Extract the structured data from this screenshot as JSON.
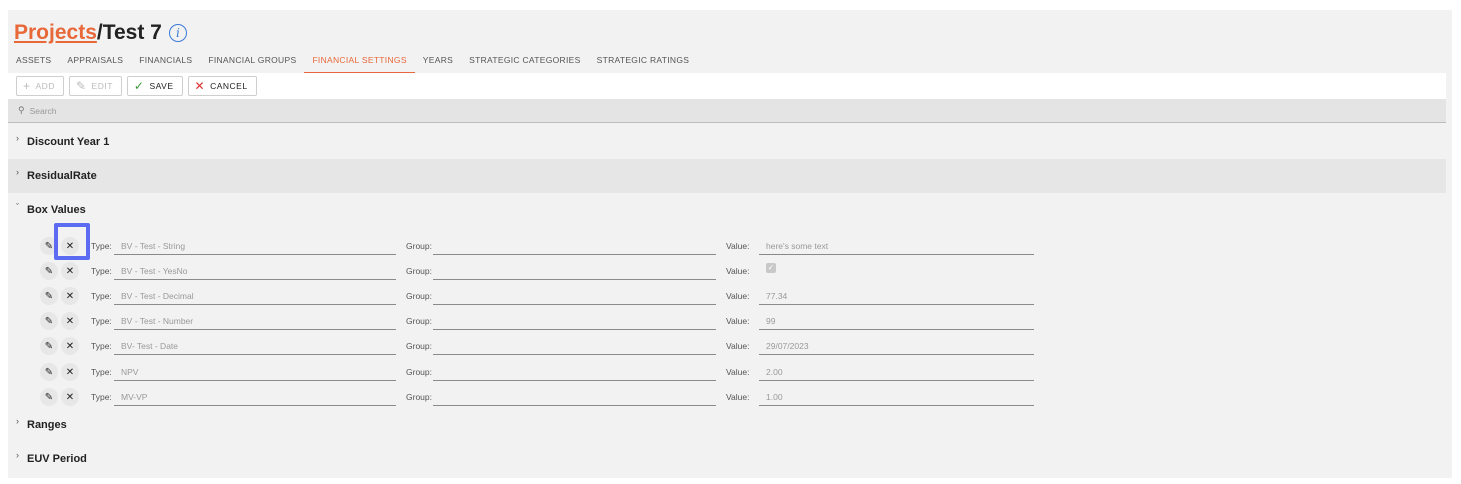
{
  "breadcrumb": {
    "link": "Projects",
    "separator": "/",
    "current": "Test 7",
    "info_icon": "info-icon"
  },
  "tabs": [
    {
      "label": "ASSETS",
      "active": false
    },
    {
      "label": "APPRAISALS",
      "active": false
    },
    {
      "label": "FINANCIALS",
      "active": false
    },
    {
      "label": "FINANCIAL GROUPS",
      "active": false
    },
    {
      "label": "FINANCIAL SETTINGS",
      "active": true
    },
    {
      "label": "YEARS",
      "active": false
    },
    {
      "label": "STRATEGIC CATEGORIES",
      "active": false
    },
    {
      "label": "STRATEGIC RATINGS",
      "active": false
    }
  ],
  "toolbar": {
    "add": {
      "label": "ADD",
      "icon": "plus-icon",
      "enabled": false
    },
    "edit": {
      "label": "EDIT",
      "icon": "pencil-icon",
      "enabled": false
    },
    "save": {
      "label": "SAVE",
      "icon": "check-icon",
      "enabled": true
    },
    "cancel": {
      "label": "CANCEL",
      "icon": "x-icon",
      "enabled": true
    }
  },
  "search": {
    "placeholder": "Search"
  },
  "groups": {
    "discount": {
      "name": "Discount Year 1",
      "expanded": false
    },
    "residual": {
      "name": "ResidualRate",
      "expanded": false
    },
    "box": {
      "name": "Box Values",
      "expanded": true
    },
    "ranges": {
      "name": "Ranges",
      "expanded": false
    },
    "euv": {
      "name": "EUV Period",
      "expanded": false
    }
  },
  "field_labels": {
    "type": "Type:",
    "group": "Group:",
    "value": "Value:"
  },
  "box_rows": [
    {
      "type": "BV - Test - String",
      "group": "",
      "value": "here's some text",
      "checkbox": false
    },
    {
      "type": "BV - Test - YesNo",
      "group": "",
      "value": "",
      "checkbox": true
    },
    {
      "type": "BV - Test - Decimal",
      "group": "",
      "value": "77.34",
      "checkbox": false
    },
    {
      "type": "BV - Test -  Number",
      "group": "",
      "value": "99",
      "checkbox": false
    },
    {
      "type": "BV- Test - Date",
      "group": "",
      "value": "29/07/2023",
      "checkbox": false
    },
    {
      "type": "NPV",
      "group": "",
      "value": "2.00",
      "checkbox": false
    },
    {
      "type": "MV-VP",
      "group": "",
      "value": "1.00",
      "checkbox": false
    }
  ],
  "colors": {
    "accent": "#e8683a",
    "info": "#3b7ad9",
    "highlight": "#5b6cf2",
    "save": "#3a9a3a",
    "cancel": "#e03030"
  }
}
